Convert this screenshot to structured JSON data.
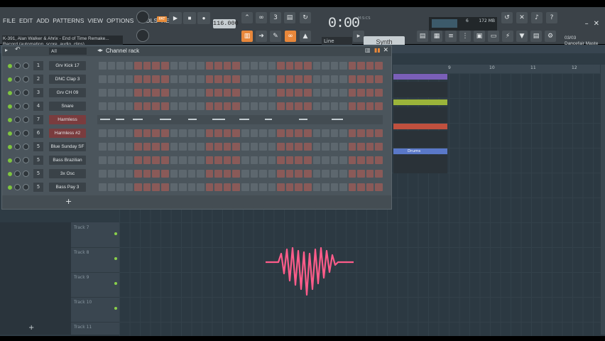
{
  "menu": [
    "FILE",
    "EDIT",
    "ADD",
    "PATTERNS",
    "VIEW",
    "OPTIONS",
    "TOOLS",
    "HELP"
  ],
  "project": {
    "title": "K-391, Alan Walker & Ahrix - End of Time Remake...",
    "hint": "Record (automation, score, audio, clips)"
  },
  "transport": {
    "pat_label": "PAT",
    "tempo": "116.000",
    "time": "0:00",
    "time_unit": "M:S:CS"
  },
  "memory": {
    "value": "172 MB",
    "cpu": "6",
    "voices": "0"
  },
  "snap": {
    "mode": "Line"
  },
  "instrument": {
    "name": "Synth"
  },
  "info": {
    "date": "03/03",
    "author": "Dancefair Maste"
  },
  "channel_rack": {
    "title": "Channel rack",
    "filter": "All",
    "channels": [
      {
        "num": "1",
        "name": "Grv Kick 17",
        "type": "steps"
      },
      {
        "num": "2",
        "name": "DNC Clap 3",
        "type": "steps"
      },
      {
        "num": "3",
        "name": "Grv CH 09",
        "type": "steps"
      },
      {
        "num": "4",
        "name": "Snare",
        "type": "steps"
      },
      {
        "num": "7",
        "name": "Harmless",
        "type": "piano",
        "selected": true
      },
      {
        "num": "6",
        "name": "Harmless #2",
        "type": "steps",
        "selected": true
      },
      {
        "num": "5",
        "name": "Blue Sunday SF",
        "type": "steps"
      },
      {
        "num": "5",
        "name": "Bass Brazilian",
        "type": "steps"
      },
      {
        "num": "5",
        "name": "3x Osc",
        "type": "steps"
      },
      {
        "num": "5",
        "name": "Bass Pay 3",
        "type": "steps"
      }
    ],
    "add_label": "+"
  },
  "playlist": {
    "ruler": [
      "9",
      "10",
      "11",
      "12"
    ],
    "tracks": [
      "Track 7",
      "Track 8",
      "Track 9",
      "Track 10",
      "Track 11"
    ],
    "clip_label": "Drums"
  },
  "colors": {
    "accent": "#e8873a",
    "heart": "#ff5c8a",
    "clip_purple": "#7a5fb8",
    "clip_green": "#9bb43a",
    "clip_red": "#c0503e",
    "clip_blue": "#5a78c8"
  }
}
